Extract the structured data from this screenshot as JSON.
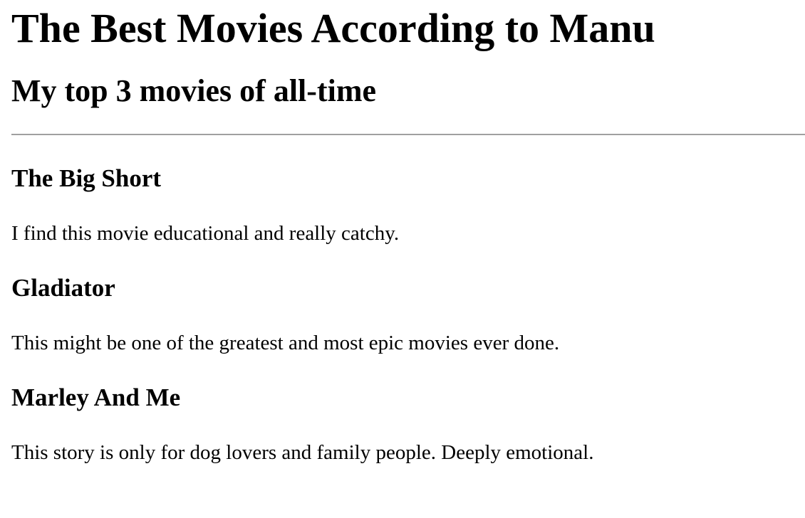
{
  "header": {
    "title": "The Best Movies According to Manu",
    "subtitle": "My top 3 movies of all-time"
  },
  "movies": [
    {
      "title": "The Big Short",
      "review": "I find this movie educational and really catchy."
    },
    {
      "title": "Gladiator",
      "review": "This might be one of the greatest and most epic movies ever done."
    },
    {
      "title": "Marley And Me",
      "review": "This story is only for dog lovers and family people. Deeply emotional."
    }
  ]
}
